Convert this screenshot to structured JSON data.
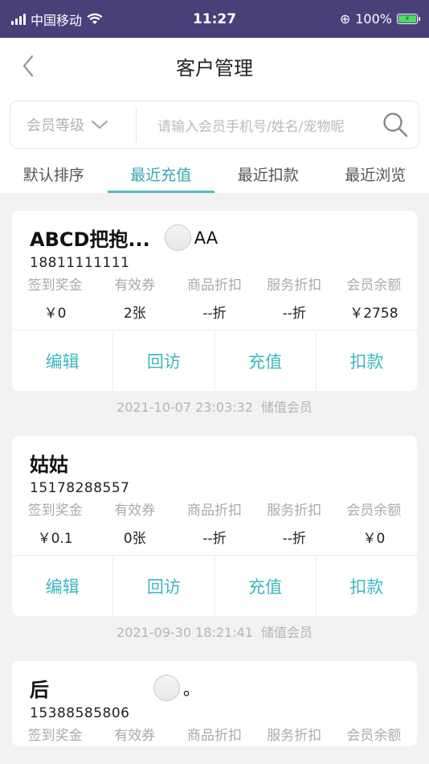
{
  "status_bar": {
    "carrier": "中国移动",
    "time": "11:27",
    "battery": "100%"
  },
  "header": {
    "title": "客户管理"
  },
  "search": {
    "level_label": "会员等级",
    "placeholder": "请输入会员手机号/姓名/宠物昵"
  },
  "tabs": [
    {
      "label": "默认排序"
    },
    {
      "label": "最近充值"
    },
    {
      "label": "最近扣款"
    },
    {
      "label": "最近浏览"
    }
  ],
  "stat_labels": [
    "签到奖金",
    "有效券",
    "商品折扣",
    "服务折扣",
    "会员余额"
  ],
  "action_labels": [
    "编辑",
    "回访",
    "充值",
    "扣款"
  ],
  "customers": [
    {
      "name": "ABCD把抱...",
      "tag": "AA",
      "phone": "18811111111",
      "values": [
        "￥0",
        "2张",
        "--折",
        "--折",
        "￥2758"
      ],
      "time": "2021-10-07 23:03:32",
      "type": "储值会员"
    },
    {
      "name": "姑姑",
      "tag": "",
      "phone": "15178288557",
      "values": [
        "￥0.1",
        "0张",
        "--折",
        "--折",
        "￥0"
      ],
      "time": "2021-09-30 18:21:41",
      "type": "储值会员"
    },
    {
      "name": "后",
      "tag": "。",
      "phone": "15388585806",
      "values": [],
      "time": "",
      "type": ""
    }
  ]
}
